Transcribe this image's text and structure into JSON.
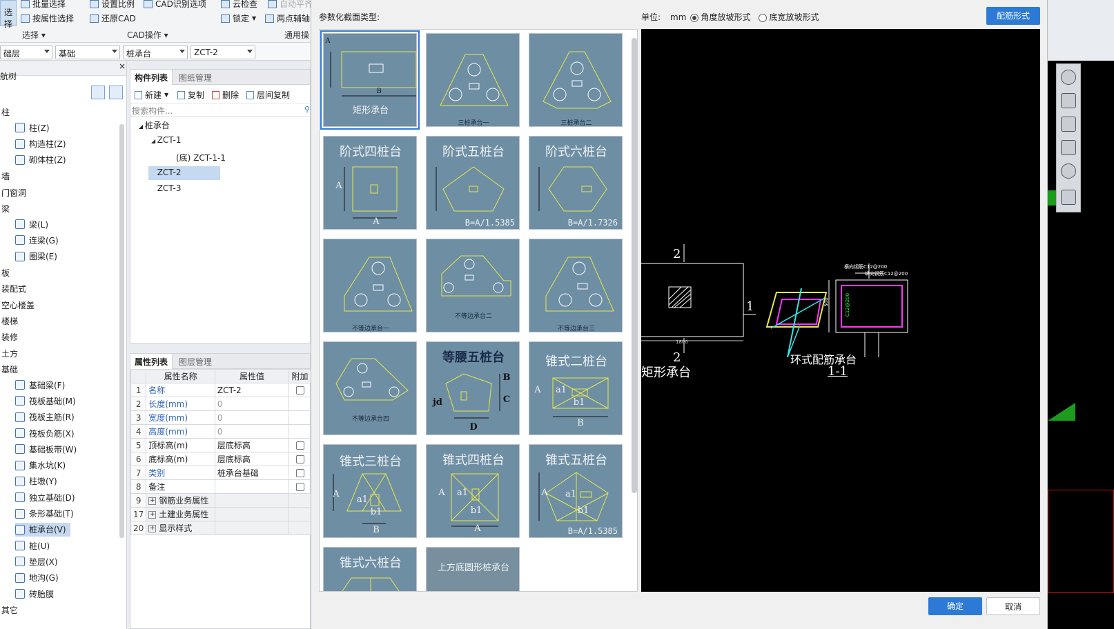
{
  "ribbon": {
    "select_button": "选择",
    "batch_select": "批量选择",
    "attr_select": "按属性选择",
    "set_scale": "设置比例",
    "restore_cad": "还原CAD",
    "cad_options": "CAD识别选项",
    "cloud_check": "云检查",
    "lock": "锁定",
    "two_point_aux": "两点辅轴",
    "auto_flat": "自动平齐",
    "group_select": "选择",
    "group_cad": "CAD操作",
    "group_aux": "通用操"
  },
  "filters": {
    "floor": "础层",
    "category": "基础",
    "type": "桩承台",
    "component": "ZCT-2"
  },
  "nav": {
    "title": "航树",
    "items": [
      {
        "kind": "cat",
        "label": "柱"
      },
      {
        "kind": "sub",
        "label": "柱(Z)"
      },
      {
        "kind": "sub",
        "label": "构造柱(Z)"
      },
      {
        "kind": "sub",
        "label": "砌体柱(Z)"
      },
      {
        "kind": "cat",
        "label": "墙"
      },
      {
        "kind": "cat",
        "label": "门窗洞"
      },
      {
        "kind": "cat",
        "label": "梁"
      },
      {
        "kind": "sub",
        "label": "梁(L)"
      },
      {
        "kind": "sub",
        "label": "连梁(G)"
      },
      {
        "kind": "sub",
        "label": "圈梁(E)"
      },
      {
        "kind": "cat",
        "label": "板"
      },
      {
        "kind": "cat",
        "label": "装配式"
      },
      {
        "kind": "cat",
        "label": "空心楼盖"
      },
      {
        "kind": "cat",
        "label": "楼梯"
      },
      {
        "kind": "cat",
        "label": "装修"
      },
      {
        "kind": "cat",
        "label": "土方"
      },
      {
        "kind": "cat",
        "label": "基础"
      },
      {
        "kind": "sub",
        "label": "基础梁(F)"
      },
      {
        "kind": "sub",
        "label": "筏板基础(M)"
      },
      {
        "kind": "sub",
        "label": "筏板主筋(R)"
      },
      {
        "kind": "sub",
        "label": "筏板负筋(X)"
      },
      {
        "kind": "sub",
        "label": "基础板带(W)"
      },
      {
        "kind": "sub",
        "label": "集水坑(K)"
      },
      {
        "kind": "sub",
        "label": "柱墩(Y)"
      },
      {
        "kind": "sub",
        "label": "独立基础(D)"
      },
      {
        "kind": "sub",
        "label": "条形基础(T)"
      },
      {
        "kind": "sub",
        "label": "桩承台(V)",
        "selected": true
      },
      {
        "kind": "sub",
        "label": "桩(U)"
      },
      {
        "kind": "sub",
        "label": "垫层(X)"
      },
      {
        "kind": "sub",
        "label": "地沟(G)"
      },
      {
        "kind": "sub",
        "label": "砖胎膜"
      },
      {
        "kind": "cat",
        "label": "其它"
      }
    ]
  },
  "component_panel": {
    "tab_list": "构件列表",
    "tab_drawing": "图纸管理",
    "new": "新建",
    "copy": "复制",
    "delete": "删除",
    "floor_copy": "层间复制",
    "search_placeholder": "搜索构件...",
    "tree": [
      {
        "label": "桩承台",
        "level": 0
      },
      {
        "label": "ZCT-1",
        "level": 1
      },
      {
        "label": "(底) ZCT-1-1",
        "level": 2
      },
      {
        "label": "ZCT-2",
        "level": 1,
        "selected": true
      },
      {
        "label": "ZCT-3",
        "level": 1
      }
    ]
  },
  "property_panel": {
    "tab_props": "属性列表",
    "tab_layers": "图层管理",
    "col_name": "属性名称",
    "col_value": "属性值",
    "col_extra": "附加",
    "rows": [
      {
        "n": "1",
        "name": "名称",
        "value": "ZCT-2",
        "blue": true,
        "check": true
      },
      {
        "n": "2",
        "name": "长度(mm)",
        "value": "0",
        "blue": true,
        "grey": true
      },
      {
        "n": "3",
        "name": "宽度(mm)",
        "value": "0",
        "blue": true,
        "grey": true
      },
      {
        "n": "4",
        "name": "高度(mm)",
        "value": "0",
        "blue": true,
        "grey": true
      },
      {
        "n": "5",
        "name": "顶标高(m)",
        "value": "层底标高",
        "check": true
      },
      {
        "n": "6",
        "name": "底标高(m)",
        "value": "层底标高",
        "check": true
      },
      {
        "n": "7",
        "name": "类别",
        "value": "桩承台基础",
        "blue": true,
        "check": true
      },
      {
        "n": "8",
        "name": "备注",
        "value": "",
        "check": true
      },
      {
        "n": "9",
        "name": "钢筋业务属性",
        "value": "",
        "group": true
      },
      {
        "n": "17",
        "name": "土建业务属性",
        "value": "",
        "group": true
      },
      {
        "n": "20",
        "name": "显示样式",
        "value": "",
        "group": true
      }
    ]
  },
  "dialog": {
    "section_label": "参数化截面类型:",
    "unit_label": "单位:",
    "unit_value": "mm",
    "radio_angle": "角度放坡形式",
    "radio_width": "底宽放坡形式",
    "rebar_button": "配筋形式",
    "ok": "确定",
    "cancel": "取消"
  },
  "gallery": {
    "rect_cap": "矩形承台",
    "three_pile_1": "三桩承台一",
    "three_pile_2": "三桩承台二",
    "step4": "阶式四桩台",
    "step5": "阶式五桩台",
    "step6": "阶式六桩台",
    "formula5": "B=A/1.5385",
    "formula6": "B=A/1.7326",
    "uneq1": "不等边承台一",
    "uneq2": "不等边承台二",
    "uneq3": "不等边承台三",
    "uneq4": "不等边承台四",
    "iso5": "等腰五桩台",
    "cone2": "锥式二桩台",
    "cone3": "锥式三桩台",
    "cone4": "锥式四桩台",
    "cone5": "锥式五桩台",
    "cone5_formula": "B=A/1.5385",
    "cone6": "锥式六桩台",
    "round_top": "上方底圆形桩承台",
    "lbl_A": "A",
    "lbl_B": "B",
    "lbl_C": "C",
    "lbl_D": "D",
    "lbl_jd": "jd",
    "lbl_a1": "a1",
    "lbl_b1": "b1"
  },
  "preview": {
    "sec2_top": "2",
    "sec2_bot": "2",
    "sec1": "1",
    "dim_1800": "1800",
    "rect_caption": "矩形承台",
    "ring_caption": "环式配筋承台",
    "section_11": "1-1",
    "rebar_h": "横向钢筋C12@200",
    "rebar_v": "纵向钢筋C12@200",
    "dim_500": "500",
    "side_rebar": "C12@200"
  }
}
